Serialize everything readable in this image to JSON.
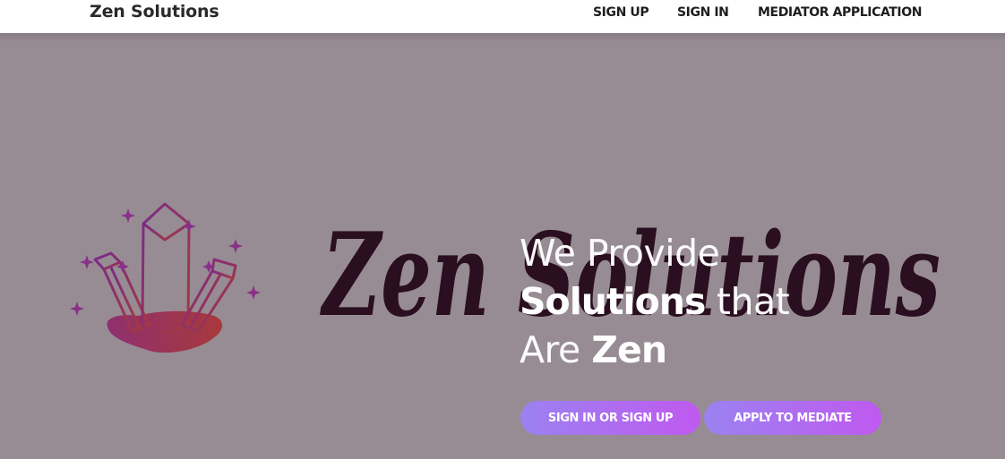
{
  "header": {
    "brand": "Zen Solutions",
    "nav": {
      "sign_up": "SIGN UP",
      "sign_in": "SIGN IN",
      "mediator_application": "MEDIATOR APPLICATION"
    }
  },
  "hero": {
    "wordmark": "Zen Solutions",
    "tagline": {
      "line1": "We Provide",
      "line2_bold": "Solutions",
      "line2_light": "that",
      "line3_light": "Are",
      "line3_bold": "Zen"
    },
    "buttons": {
      "primary": "SIGN IN OR SIGN UP",
      "secondary": "APPLY TO MEDIATE"
    },
    "logo_icon": "crystal-cluster-icon"
  },
  "colors": {
    "hero_background": "#978c93",
    "button_gradient_start": "#9b82f0",
    "button_gradient_end": "#c059f0",
    "wordmark": "#2a0f20",
    "crystal_gradient_start": "#7a2a8a",
    "crystal_gradient_end": "#a83a3a"
  }
}
